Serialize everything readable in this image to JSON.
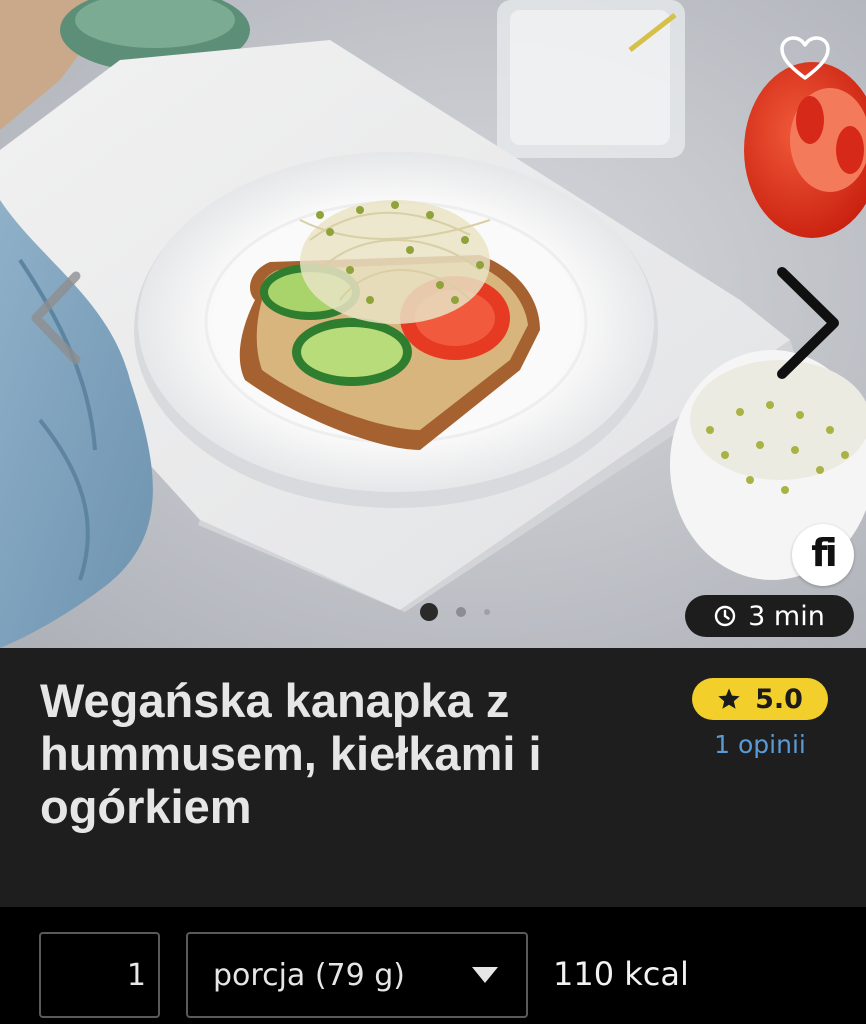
{
  "hero": {
    "time": "3 min",
    "brand_badge": "fi",
    "carousel": {
      "pages": 3,
      "active": 1
    },
    "icons": {
      "favorite": "heart-outline-icon",
      "prev": "chevron-left-icon",
      "next": "chevron-right-icon",
      "time": "clock-icon"
    }
  },
  "recipe": {
    "title": "Wegańska kanapka z hummusem, kiełkami i ogórkiem",
    "rating": "5.0",
    "reviews": "1 opinii",
    "rating_color": "#f2cf2a",
    "link_color": "#5b9bd5"
  },
  "portion": {
    "quantity": "1",
    "unit": "porcja (79 g)",
    "kcal": "110 kcal"
  }
}
